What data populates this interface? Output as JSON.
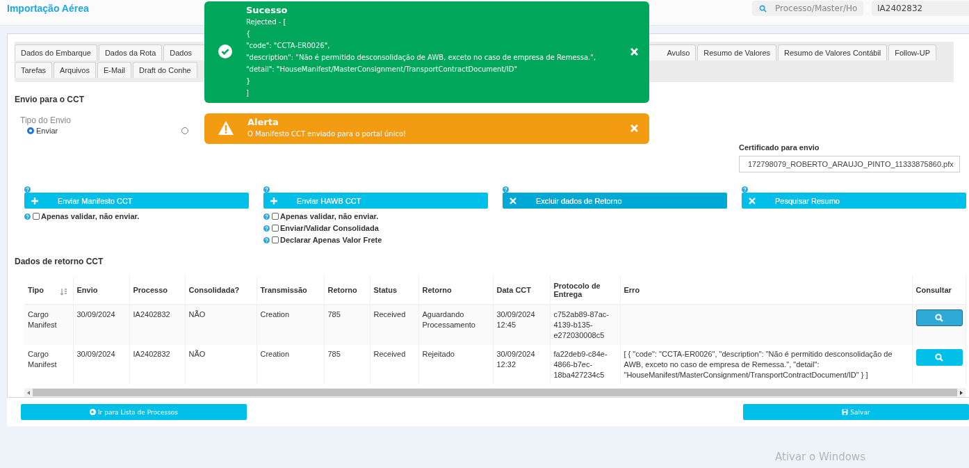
{
  "header": {
    "title": "Importação Aérea",
    "search": {
      "placeholder": "Processo/Master/Ho"
    },
    "process_field": {
      "value": "IA2402832"
    }
  },
  "tabs_row_1": [
    {
      "label": "Dados do Embarque",
      "selected": false
    },
    {
      "label": "Dados da Rota",
      "selected": false
    },
    {
      "label": "Dados",
      "selected": false
    }
  ],
  "tabs_row_1_right": [
    {
      "label": "Avulso",
      "selected": false
    },
    {
      "label": "Resumo de Valores",
      "selected": false
    },
    {
      "label": "Resumo de Valores Contábil",
      "selected": false
    },
    {
      "label": "Follow-UP",
      "selected": false
    }
  ],
  "tabs_row_2": [
    {
      "label": "Tarefas",
      "selected": false
    },
    {
      "label": "Arquivos",
      "selected": false
    },
    {
      "label": "E-Mail",
      "selected": false
    },
    {
      "label": "Draft do Conhe",
      "selected": false
    }
  ],
  "section_title": "Envio para o CCT",
  "send_type": {
    "label": "Tipo do Envio",
    "options": [
      {
        "label": "Enviar",
        "selected": true
      },
      {
        "selected": false
      }
    ]
  },
  "certificate": {
    "label": "Certificado para envio",
    "value": "172798079_ROBERTO_ARAUJO_PINTO_11333875860.pfx"
  },
  "actions": [
    {
      "label": "Enviar Manifesto CCT",
      "kind": "add",
      "hovered": false,
      "checks": [
        {
          "label": "Apenas validar, não enviar.",
          "checked": false
        }
      ]
    },
    {
      "label": "Enviar HAWB CCT",
      "kind": "add",
      "hovered": false,
      "checks": [
        {
          "label": "Apenas validar, não enviar.",
          "checked": false
        },
        {
          "label": "Enviar/Validar Consolidada",
          "checked": false
        },
        {
          "label": "Declarar Apenas Valor Frete",
          "checked": false
        }
      ]
    },
    {
      "label": "Excluir dados de Retorno",
      "kind": "remove",
      "hovered": true
    },
    {
      "label": "Pesquisar Resumo",
      "kind": "remove",
      "hovered": false
    }
  ],
  "return_title": "Dados de retorno CCT",
  "table": {
    "columns": [
      "Tipo",
      "Envio",
      "Processo",
      "Consolidada?",
      "Transmissão",
      "Retorno",
      "Status",
      "Retorno",
      "Data CCT",
      "Protocolo de Entrega",
      "Erro",
      "Consultar"
    ],
    "rows": [
      {
        "cells": [
          "Cargo Manifest",
          "30/09/2024",
          "IA2402832",
          "NÃO",
          "Creation",
          "785",
          "Received",
          "Aguardando Processamento",
          "30/09/2024 12:45",
          "c752ab89-87ac-4139-b135-e272030008c5",
          ""
        ],
        "focused": true
      },
      {
        "cells": [
          "Cargo Manifest",
          "30/09/2024",
          "IA2402832",
          "NÃO",
          "Creation",
          "785",
          "Received",
          "Rejeitado",
          "30/09/2024 12:32",
          "fa22deb9-c84e-4866-b7ec-18ba427234c5",
          "[ { \"code\": \"CCTA-ER0026\", \"description\": \"Não é permitido desconsolidação de AWB, exceto no caso de empresa de Remessa.\", \"detail\": \"HouseManifest/MasterConsignment/TransportContractDocument/ID\" } ]"
        ],
        "focused": false
      }
    ]
  },
  "footer_buttons": [
    {
      "label": "Ir para Lista de Processos",
      "kind": "back"
    },
    {
      "label": "Salvar",
      "kind": "save"
    }
  ],
  "toasts": [
    {
      "kind": "success",
      "title": "Sucesso",
      "lines": [
        "Rejected - [",
        "{",
        "\"code\": \"CCTA-ER0026\",",
        "\"description\": \"Não é permitido desconsolidação de AWB, exceto no caso de empresa de Remessa.\",",
        "\"detail\": \"HouseManifest/MasterConsignment/TransportContractDocument/ID\"",
        "}",
        "]"
      ]
    },
    {
      "kind": "warning",
      "title": "Alerta",
      "lines": [
        "O Manifesto CCT enviado para o portal único!"
      ]
    }
  ],
  "os_notice": "Ativar o Windows"
}
